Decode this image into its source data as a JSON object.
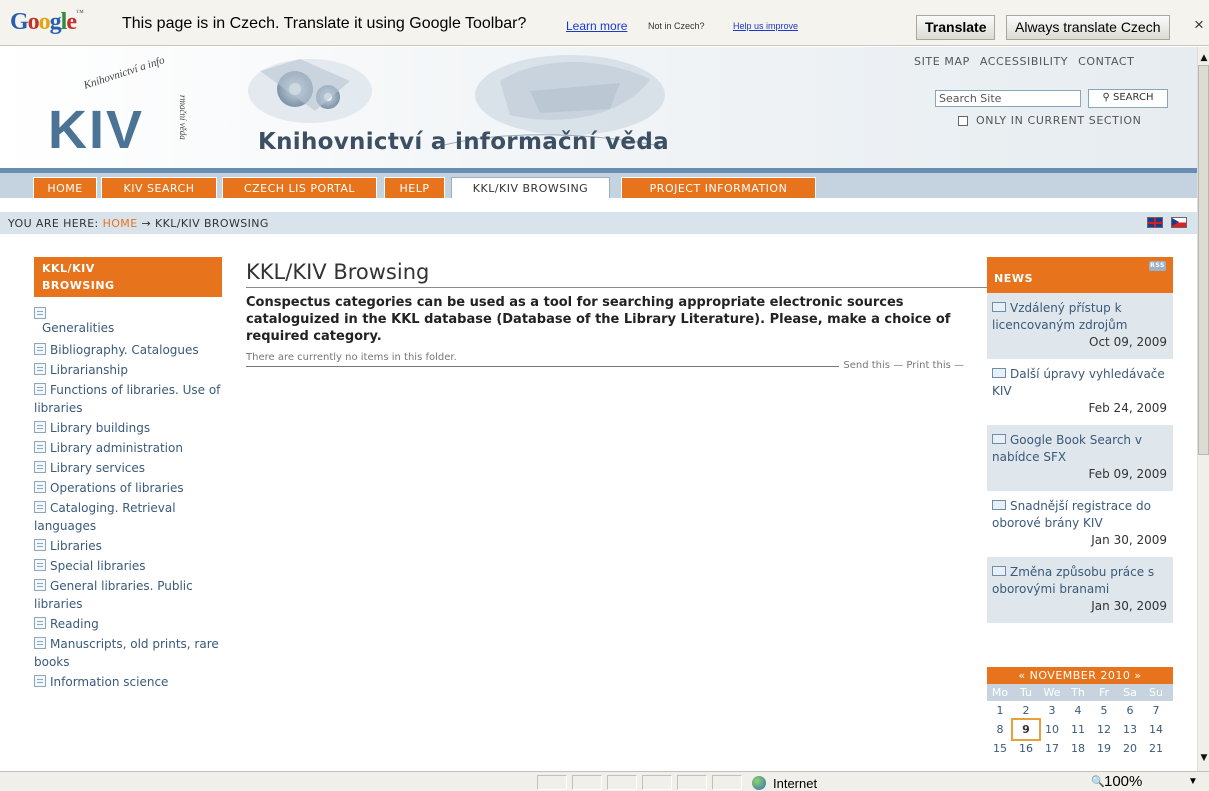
{
  "translate_bar": {
    "logo": "Google",
    "message": "This page is in Czech.  Translate it using Google Toolbar?",
    "learn_more": "Learn more",
    "not_in_czech": "Not in Czech?",
    "help_improve": "Help us improve",
    "translate_btn": "Translate",
    "always_btn": "Always translate Czech",
    "close": "×"
  },
  "header": {
    "logo_text": "KIV",
    "arc_text_top": "Knihovnictví a info",
    "arc_text_side": "rmační věda",
    "site_title": "Knihovnictví a informační věda",
    "top_links": [
      "SITE MAP",
      "ACCESSIBILITY",
      "CONTACT"
    ],
    "search_placeholder": "Search Site",
    "search_button": "SEARCH",
    "only_current": "ONLY IN CURRENT SECTION"
  },
  "nav": {
    "tabs": [
      {
        "label": "HOME"
      },
      {
        "label": "KIV SEARCH"
      },
      {
        "label": "CZECH LIS PORTAL"
      },
      {
        "label": "HELP"
      },
      {
        "label": "KKL/KIV BROWSING",
        "active": true
      },
      {
        "label": "PROJECT INFORMATION"
      }
    ]
  },
  "breadcrumb": {
    "prefix": "YOU ARE HERE:",
    "home": "HOME",
    "arrow": "→",
    "current": "KKL/KIV BROWSING"
  },
  "left": {
    "heading_1": "KKL/KIV",
    "heading_2": "BROWSING",
    "items": [
      "Generalities",
      "Bibliography. Catalogues",
      "Librarianship",
      "Functions of libraries. Use of libraries",
      "Library buildings",
      "Library administration",
      "Library services",
      "Operations of libraries",
      "Cataloging. Retrieval languages",
      "Libraries",
      "Special libraries",
      "General libraries. Public libraries",
      "Reading",
      "Manuscripts, old prints, rare books",
      "Information science"
    ]
  },
  "main": {
    "title": "KKL/KIV Browsing",
    "description": "Conspectus categories can be used as a tool for searching appropriate electronic sources cataloguized in the KKL database (Database of the Library Literature). Please, make a choice of required category.",
    "empty": "There are currently no items in this folder.",
    "send_this": "Send this",
    "print_this": "Print this"
  },
  "news": {
    "heading": "NEWS",
    "rss": "RSS",
    "items": [
      {
        "title": "Vzdálený přístup k licencovaným zdrojům",
        "date": "Oct 09, 2009"
      },
      {
        "title": "Další úpravy vyhledávače KIV",
        "date": "Feb 24, 2009"
      },
      {
        "title": "Google Book Search v nabídce SFX",
        "date": "Feb 09, 2009"
      },
      {
        "title": "Snadnější registrace do oborové brány KIV",
        "date": "Jan 30, 2009"
      },
      {
        "title": "Změna způsobu práce s oborovými branami",
        "date": "Jan 30, 2009"
      }
    ]
  },
  "calendar": {
    "month": "« NOVEMBER 2010 »",
    "days": [
      "Mo",
      "Tu",
      "We",
      "Th",
      "Fr",
      "Sa",
      "Su"
    ],
    "weeks": [
      [
        "1",
        "2",
        "3",
        "4",
        "5",
        "6",
        "7"
      ],
      [
        "8",
        "9",
        "10",
        "11",
        "12",
        "13",
        "14"
      ],
      [
        "15",
        "16",
        "17",
        "18",
        "19",
        "20",
        "21"
      ]
    ],
    "today": "9"
  },
  "statusbar": {
    "zone": "Internet",
    "zoom": "100%"
  },
  "colors": {
    "accent_orange": "#e7731c",
    "nav_blue": "#6a8eb3",
    "link_blue": "#3a5a7a"
  }
}
